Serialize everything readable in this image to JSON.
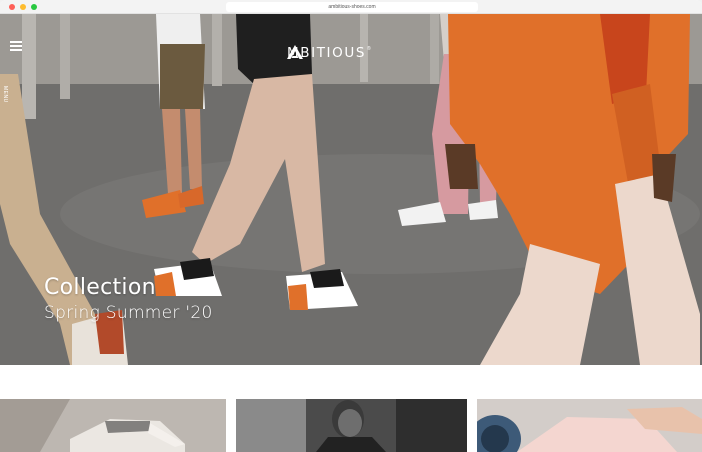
{
  "browser": {
    "url": "ambitious-shoes.com"
  },
  "header": {
    "menu_label": "MENU",
    "logo_text": "MBITIOUS",
    "logo_reg": "®"
  },
  "hero": {
    "title": "Collection",
    "subtitle": "Spring Summer '20"
  },
  "colors": {
    "accent_orange": "#e0702a",
    "text_on_hero": "#ffffff",
    "page_background": "#ffffff"
  },
  "icons": {
    "menu": "hamburger-icon",
    "logo": "ambitious-a-logo"
  },
  "tiles": [
    {
      "name": "sneaker-tile"
    },
    {
      "name": "model-tile"
    },
    {
      "name": "shoe-detail-tile"
    }
  ]
}
